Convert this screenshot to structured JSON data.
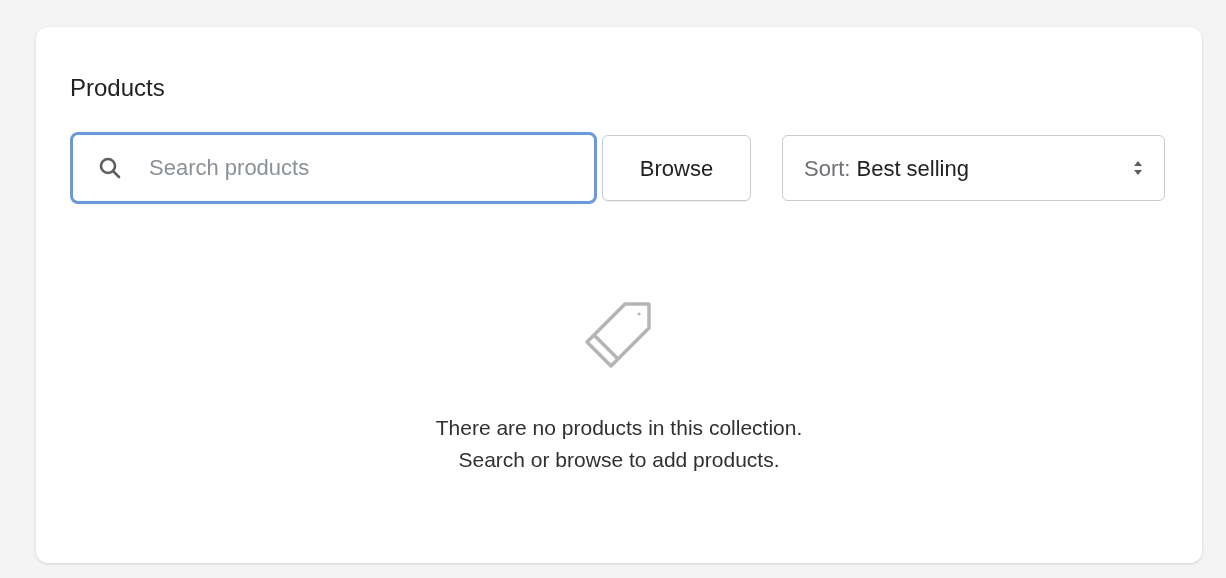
{
  "card": {
    "title": "Products"
  },
  "search": {
    "placeholder": "Search products",
    "focused": true
  },
  "browse_button": "Browse",
  "sort": {
    "label": "Sort:",
    "value": "Best selling"
  },
  "empty_state": {
    "lines": [
      "There are no products in this collection.",
      "Search or browse to add products."
    ]
  }
}
